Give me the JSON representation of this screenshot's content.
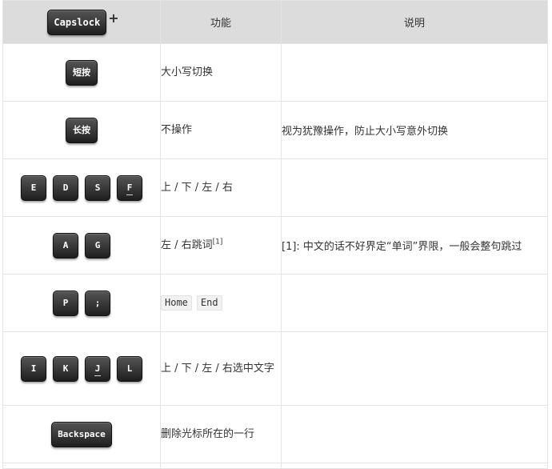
{
  "header": {
    "key_label": "Capslock",
    "plus": "+",
    "col_function": "功能",
    "col_description": "说明"
  },
  "rows": [
    {
      "keys": [
        "短按"
      ],
      "function": "大小写切换",
      "description": ""
    },
    {
      "keys": [
        "长按"
      ],
      "function": "不操作",
      "description": "视为犹豫操作，防止大小写意外切换"
    },
    {
      "keys": [
        "E",
        "D",
        "S",
        "F"
      ],
      "function": "上 / 下 / 左 / 右",
      "description": ""
    },
    {
      "keys": [
        "A",
        "G"
      ],
      "function": "左 / 右跳词",
      "function_sup": "[1]",
      "description": "[1]: 中文的话不好界定“单词”界限，一般会整句跳过"
    },
    {
      "keys": [
        "P",
        ";"
      ],
      "function_codes": [
        "Home",
        "End"
      ],
      "description": ""
    },
    {
      "keys": [
        "I",
        "K",
        "J",
        "L"
      ],
      "function": "上 / 下 / 左 / 右选中文字",
      "description": ""
    },
    {
      "keys": [
        "Backspace"
      ],
      "function": "删除光标所在的一行",
      "description": ""
    }
  ]
}
